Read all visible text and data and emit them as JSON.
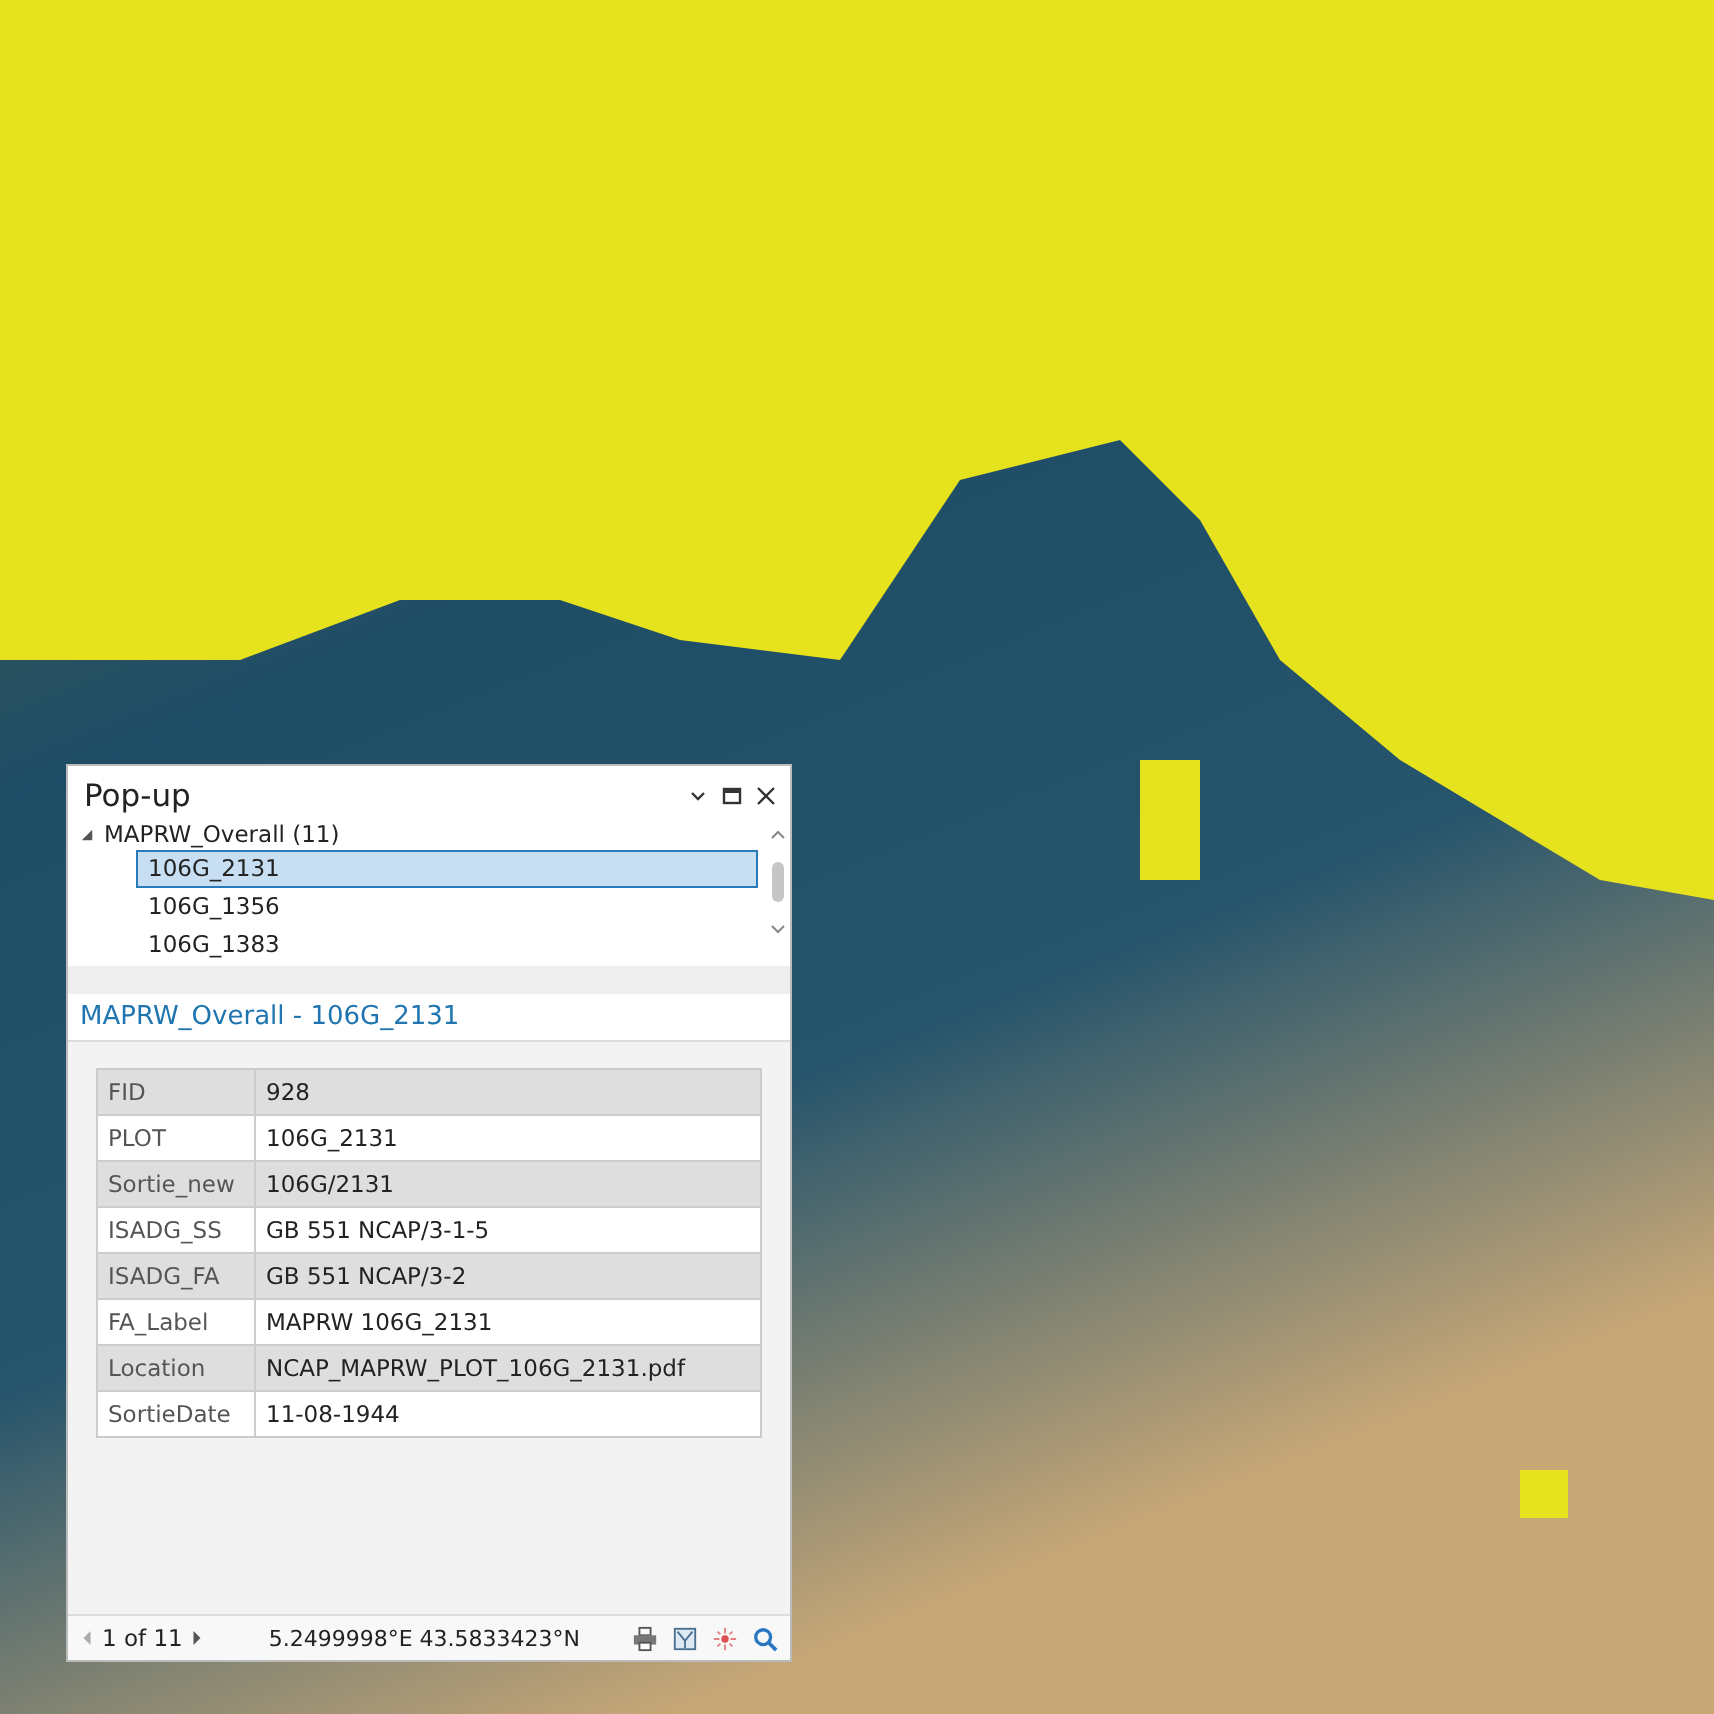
{
  "panel": {
    "title": "Pop-up"
  },
  "tree": {
    "label": "MAPRW_Overall (11)",
    "expanded": true,
    "children": [
      {
        "label": "106G_2131",
        "selected": true
      },
      {
        "label": "106G_1356",
        "selected": false
      },
      {
        "label": "106G_1383",
        "selected": false
      }
    ]
  },
  "feature_title": "MAPRW_Overall - 106G_2131",
  "table": {
    "rows": [
      {
        "field": "FID",
        "value": "928"
      },
      {
        "field": "PLOT",
        "value": "106G_2131"
      },
      {
        "field": "Sortie_new",
        "value": "106G/2131"
      },
      {
        "field": "ISADG_SS",
        "value": "GB 551 NCAP/3-1-5"
      },
      {
        "field": "ISADG_FA",
        "value": "GB 551 NCAP/3-2"
      },
      {
        "field": "FA_Label",
        "value": "MAPRW 106G_2131"
      },
      {
        "field": "Location",
        "value": "NCAP_MAPRW_PLOT_106G_2131.pdf"
      },
      {
        "field": "SortieDate",
        "value": "11-08-1944"
      }
    ]
  },
  "footer": {
    "counter": "1 of 11",
    "coordinates": "5.2499998°E 43.5833423°N"
  }
}
